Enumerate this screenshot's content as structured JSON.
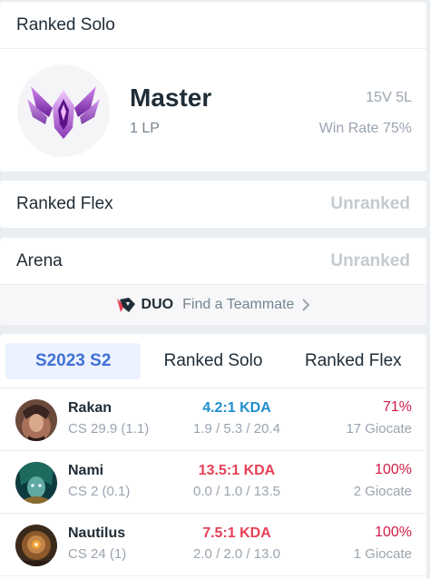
{
  "ranked_solo": {
    "title": "Ranked Solo",
    "emblem_icon": "master-emblem-icon",
    "tier": "Master",
    "lp": "1 LP",
    "record": "15V 5L",
    "win_rate": "Win Rate 75%"
  },
  "ranked_flex": {
    "title": "Ranked Flex",
    "status": "Unranked"
  },
  "arena": {
    "title": "Arena",
    "status": "Unranked",
    "duo_icon": "duo-logo-icon",
    "duo_label": "DUO",
    "find_label": "Find a Teammate",
    "chevron_icon": "chevron-right-icon"
  },
  "champion_stats": {
    "tabs": [
      {
        "label": "S2023 S2",
        "active": true
      },
      {
        "label": "Ranked Solo",
        "active": false
      },
      {
        "label": "Ranked Flex",
        "active": false
      }
    ],
    "rows": [
      {
        "name": "Rakan",
        "cs": "CS 29.9 (1.1)",
        "kda": "4.2:1 KDA",
        "kda_color": "#1f8ecd",
        "kda_detail": "1.9 / 5.3 / 20.4",
        "win_rate": "71%",
        "games": "17 Giocate"
      },
      {
        "name": "Nami",
        "cs": "CS 2 (0.1)",
        "kda": "13.5:1 KDA",
        "kda_color": "#e84057",
        "kda_detail": "0.0 / 1.0 / 13.5",
        "win_rate": "100%",
        "games": "2 Giocate"
      },
      {
        "name": "Nautilus",
        "cs": "CS 24 (1)",
        "kda": "7.5:1 KDA",
        "kda_color": "#e84057",
        "kda_detail": "2.0 / 2.0 / 13.0",
        "win_rate": "100%",
        "games": "1 Giocate"
      }
    ]
  },
  "colors": {
    "background": "#ebeef1",
    "accent_blue": "#4171d6",
    "kda_blue": "#1f8ecd",
    "kda_red": "#e84057",
    "winrate_red": "#d31a45"
  }
}
